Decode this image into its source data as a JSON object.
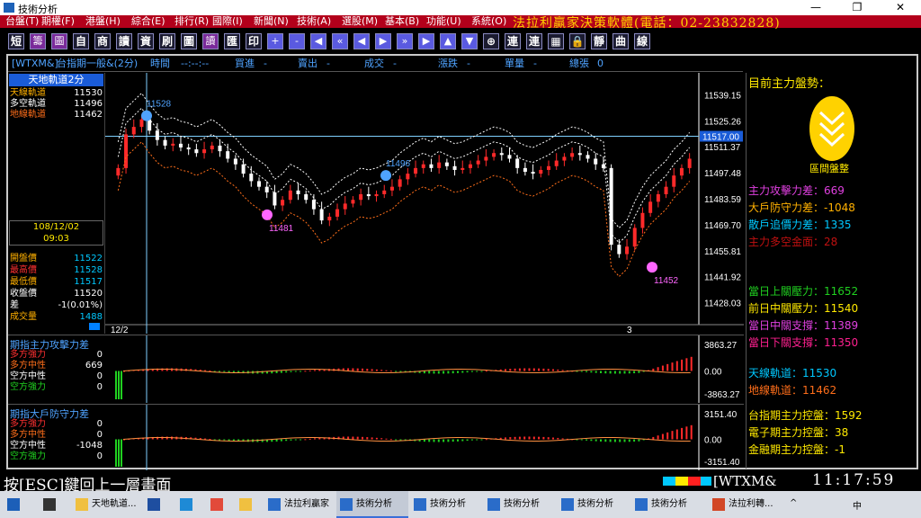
{
  "window": {
    "title": "技術分析",
    "minimize": "—",
    "maximize": "❐",
    "close": "✕"
  },
  "menu": {
    "items": [
      "台盤(T)",
      "期權(F)",
      "港盤(H)",
      "綜合(E)",
      "排行(R)",
      "國際(I)",
      "新聞(N)",
      "技術(A)",
      "選股(M)",
      "基本(B)",
      "功能(U)",
      "系統(O)"
    ],
    "banner": "法拉利贏家決策軟體(電話：02-23832828)"
  },
  "toolbar": {
    "buttons": [
      "短",
      "籌",
      "圖",
      "自",
      "商",
      "讀",
      "資",
      "刷",
      "圖",
      "讀",
      "匯",
      "印",
      "+",
      "-",
      "◀",
      "«",
      "◀",
      "▶",
      "»",
      "▶",
      "▲",
      "▼",
      "⊕",
      "連",
      "連",
      "▦",
      "🔒",
      "靜",
      "曲",
      "線"
    ]
  },
  "header": {
    "code": "[WTXM&]",
    "name": "台指期一般&(2分)",
    "time_label": "時間",
    "time_value": "--:--:--",
    "buy_label": "買進",
    "buy_value": "-",
    "sell_label": "賣出",
    "sell_value": "-",
    "deal_label": "成交",
    "deal_value": "-",
    "change_label": "漲跌",
    "change_value": "-",
    "vol_label": "單量",
    "vol_value": "-",
    "total_label": "總張",
    "total_value": "0"
  },
  "left_panel": {
    "title": "天地軌道2分",
    "rows": [
      {
        "label": "天線軌道",
        "value": "11530",
        "color": "#ffb000"
      },
      {
        "label": "多空軌道",
        "value": "11496",
        "color": "#ffffff"
      },
      {
        "label": "地線軌道",
        "value": "11462",
        "color": "#ff6e1a"
      }
    ],
    "date": "108/12/02",
    "time": "09:03",
    "quote_rows": [
      {
        "label": "開盤價",
        "value": "11522",
        "label_color": "#ffb000",
        "value_color": "#00c8ff"
      },
      {
        "label": "最高價",
        "value": "11528",
        "label_color": "#ff3030",
        "value_color": "#00c8ff"
      },
      {
        "label": "最低價",
        "value": "11517",
        "label_color": "#ffb000",
        "value_color": "#00c8ff"
      },
      {
        "label": "收盤價",
        "value": "11520",
        "label_color": "#ffffff",
        "value_color": "#ffffff"
      },
      {
        "label": "差",
        "value": "-1(0.01%)",
        "label_color": "#ffffff",
        "value_color": "#ffffff"
      },
      {
        "label": "成交量",
        "value": "1488",
        "label_color": "#ffb000",
        "value_color": "#00c8ff"
      }
    ]
  },
  "chart_data": {
    "type": "candlestick",
    "y_ticks": [
      "11539.15",
      "11525.26",
      "11511.37",
      "11497.48",
      "11483.59",
      "11469.70",
      "11455.81",
      "11441.92",
      "11428.03"
    ],
    "ylim": [
      11421.09,
      11546.09
    ],
    "current_price_label": "11517.00",
    "x_labels": [
      "12/2",
      "3"
    ],
    "annotations": [
      {
        "text": "11528",
        "color": "#4fa3ff"
      },
      {
        "text": "11496",
        "color": "#4fa3ff"
      },
      {
        "text": "11481",
        "color": "#ff66ff"
      },
      {
        "text": "11452",
        "color": "#ff66ff"
      }
    ],
    "close_series": [
      11500,
      11518,
      11522,
      11526,
      11520,
      11515,
      11512,
      11513,
      11511,
      11510,
      11508,
      11510,
      11512,
      11509,
      11505,
      11502,
      11497,
      11493,
      11490,
      11487,
      11480,
      11483,
      11488,
      11486,
      11483,
      11478,
      11472,
      11474,
      11478,
      11481,
      11483,
      11486,
      11485,
      11486,
      11488,
      11490,
      11494,
      11497,
      11500,
      11502,
      11500,
      11503,
      11501,
      11499,
      11500,
      11502,
      11504,
      11506,
      11508,
      11507,
      11505,
      11500,
      11498,
      11497,
      11499,
      11501,
      11504,
      11506,
      11508,
      11507,
      11505,
      11502,
      11500,
      11459,
      11454,
      11458,
      11468,
      11476,
      11482,
      11486,
      11490,
      11496,
      11500,
      11505
    ]
  },
  "sub1": {
    "title": "期指主力攻擊力差",
    "rows": [
      {
        "label": "多方強力",
        "value": "0",
        "color": "#ff3030"
      },
      {
        "label": "多方中性",
        "value": "669",
        "color": "#ff6e1a"
      },
      {
        "label": "空方中性",
        "value": "0",
        "color": "#ffffff"
      },
      {
        "label": "空方強力",
        "value": "0",
        "color": "#20d020"
      }
    ],
    "y_ticks": [
      "3863.27",
      "0.00",
      "-3863.27"
    ]
  },
  "sub2": {
    "title": "期指大戶防守力差",
    "rows": [
      {
        "label": "多方強力",
        "value": "0",
        "color": "#ff3030"
      },
      {
        "label": "多方中性",
        "value": "0",
        "color": "#ff6e1a"
      },
      {
        "label": "空方中性",
        "value": "-1048",
        "color": "#ffffff"
      },
      {
        "label": "空方強力",
        "value": "0",
        "color": "#20d020"
      }
    ],
    "y_ticks": [
      "3151.40",
      "0.00",
      "-3151.40"
    ]
  },
  "right_panel": {
    "heading": "目前主力盤勢：",
    "badge_label": "區間盤整",
    "rows1": [
      {
        "text": "主力攻擊力差：669",
        "color": "#e040e0"
      },
      {
        "text": "大戶防守力差：-1048",
        "color": "#ffb000"
      },
      {
        "text": "散戶追價力差：1335",
        "color": "#00c8ff"
      },
      {
        "text": "主力多空金面：28",
        "color": "#c01010"
      }
    ],
    "rows2": [
      {
        "text": "當日上關壓力：11652",
        "color": "#20d020"
      },
      {
        "text": "前日中關壓力：11540",
        "color": "#ffe900"
      },
      {
        "text": "當日中關支撐：11389",
        "color": "#e040e0"
      },
      {
        "text": "當日下關支撐：11350",
        "color": "#ff2090"
      }
    ],
    "rows3": [
      {
        "text": "天線軌道：11530",
        "color": "#00c8ff"
      },
      {
        "text": "地線軌道：11462",
        "color": "#ff6e1a"
      }
    ],
    "rows4": [
      {
        "text": "台指期主力控盤：1592",
        "color": "#ffe900"
      },
      {
        "text": "電子期主力控盤：38",
        "color": "#ffe900"
      },
      {
        "text": "金融期主力控盤：-1",
        "color": "#ffe900"
      }
    ]
  },
  "status": {
    "hint": "按[ESC]鍵回上一層畫面",
    "code": "[WTXM&",
    "clock": "11:17:59"
  },
  "taskbar": {
    "items": [
      {
        "label": "",
        "icon": "windows-icon"
      },
      {
        "label": "",
        "icon": "task-view-icon"
      },
      {
        "label": "天地軌道...",
        "icon": "folder-icon"
      },
      {
        "label": "",
        "icon": "terminal-icon"
      },
      {
        "label": "",
        "icon": "edge-icon"
      },
      {
        "label": "",
        "icon": "chrome-icon"
      },
      {
        "label": "",
        "icon": "folder-icon"
      },
      {
        "label": "法拉利贏家",
        "icon": "app-icon"
      },
      {
        "label": "技術分析",
        "icon": "chart-icon"
      },
      {
        "label": "技術分析",
        "icon": "chart-icon"
      },
      {
        "label": "技術分析",
        "icon": "chart-icon"
      },
      {
        "label": "技術分析",
        "icon": "chart-icon"
      },
      {
        "label": "技術分析",
        "icon": "chart-icon"
      },
      {
        "label": "法拉利轉...",
        "icon": "ppt-icon"
      }
    ],
    "tray": [
      "^",
      "中"
    ]
  }
}
